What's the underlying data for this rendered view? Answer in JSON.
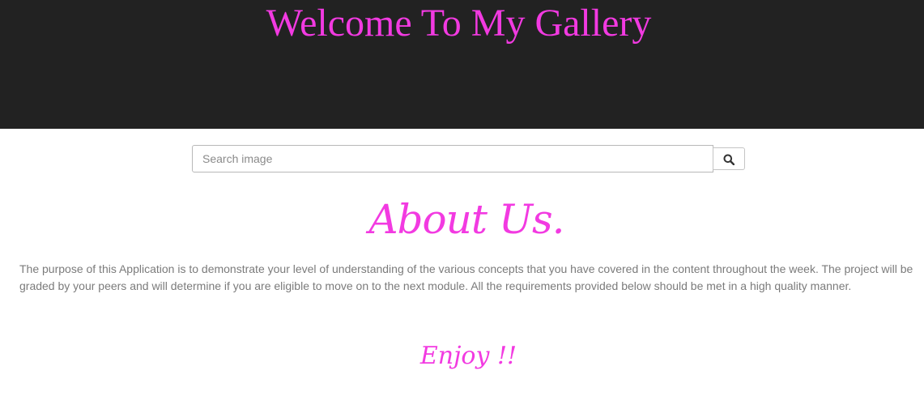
{
  "header": {
    "title": "Welcome To My Gallery"
  },
  "search": {
    "placeholder": "Search image",
    "value": "",
    "button_icon": "search-icon"
  },
  "about": {
    "heading": "About Us.",
    "text": "The purpose of this Application is to demonstrate your level of understanding of the various concepts that you have covered in the content throughout the week. The project will be graded by your peers and will determine if you are eligible to move on to the next module. All the requirements provided below should be met in a high quality manner."
  },
  "closing": {
    "text": "Enjoy !!"
  },
  "colors": {
    "header_background": "#222222",
    "accent": "#f23ae1",
    "body_text": "#7b7b7b"
  }
}
